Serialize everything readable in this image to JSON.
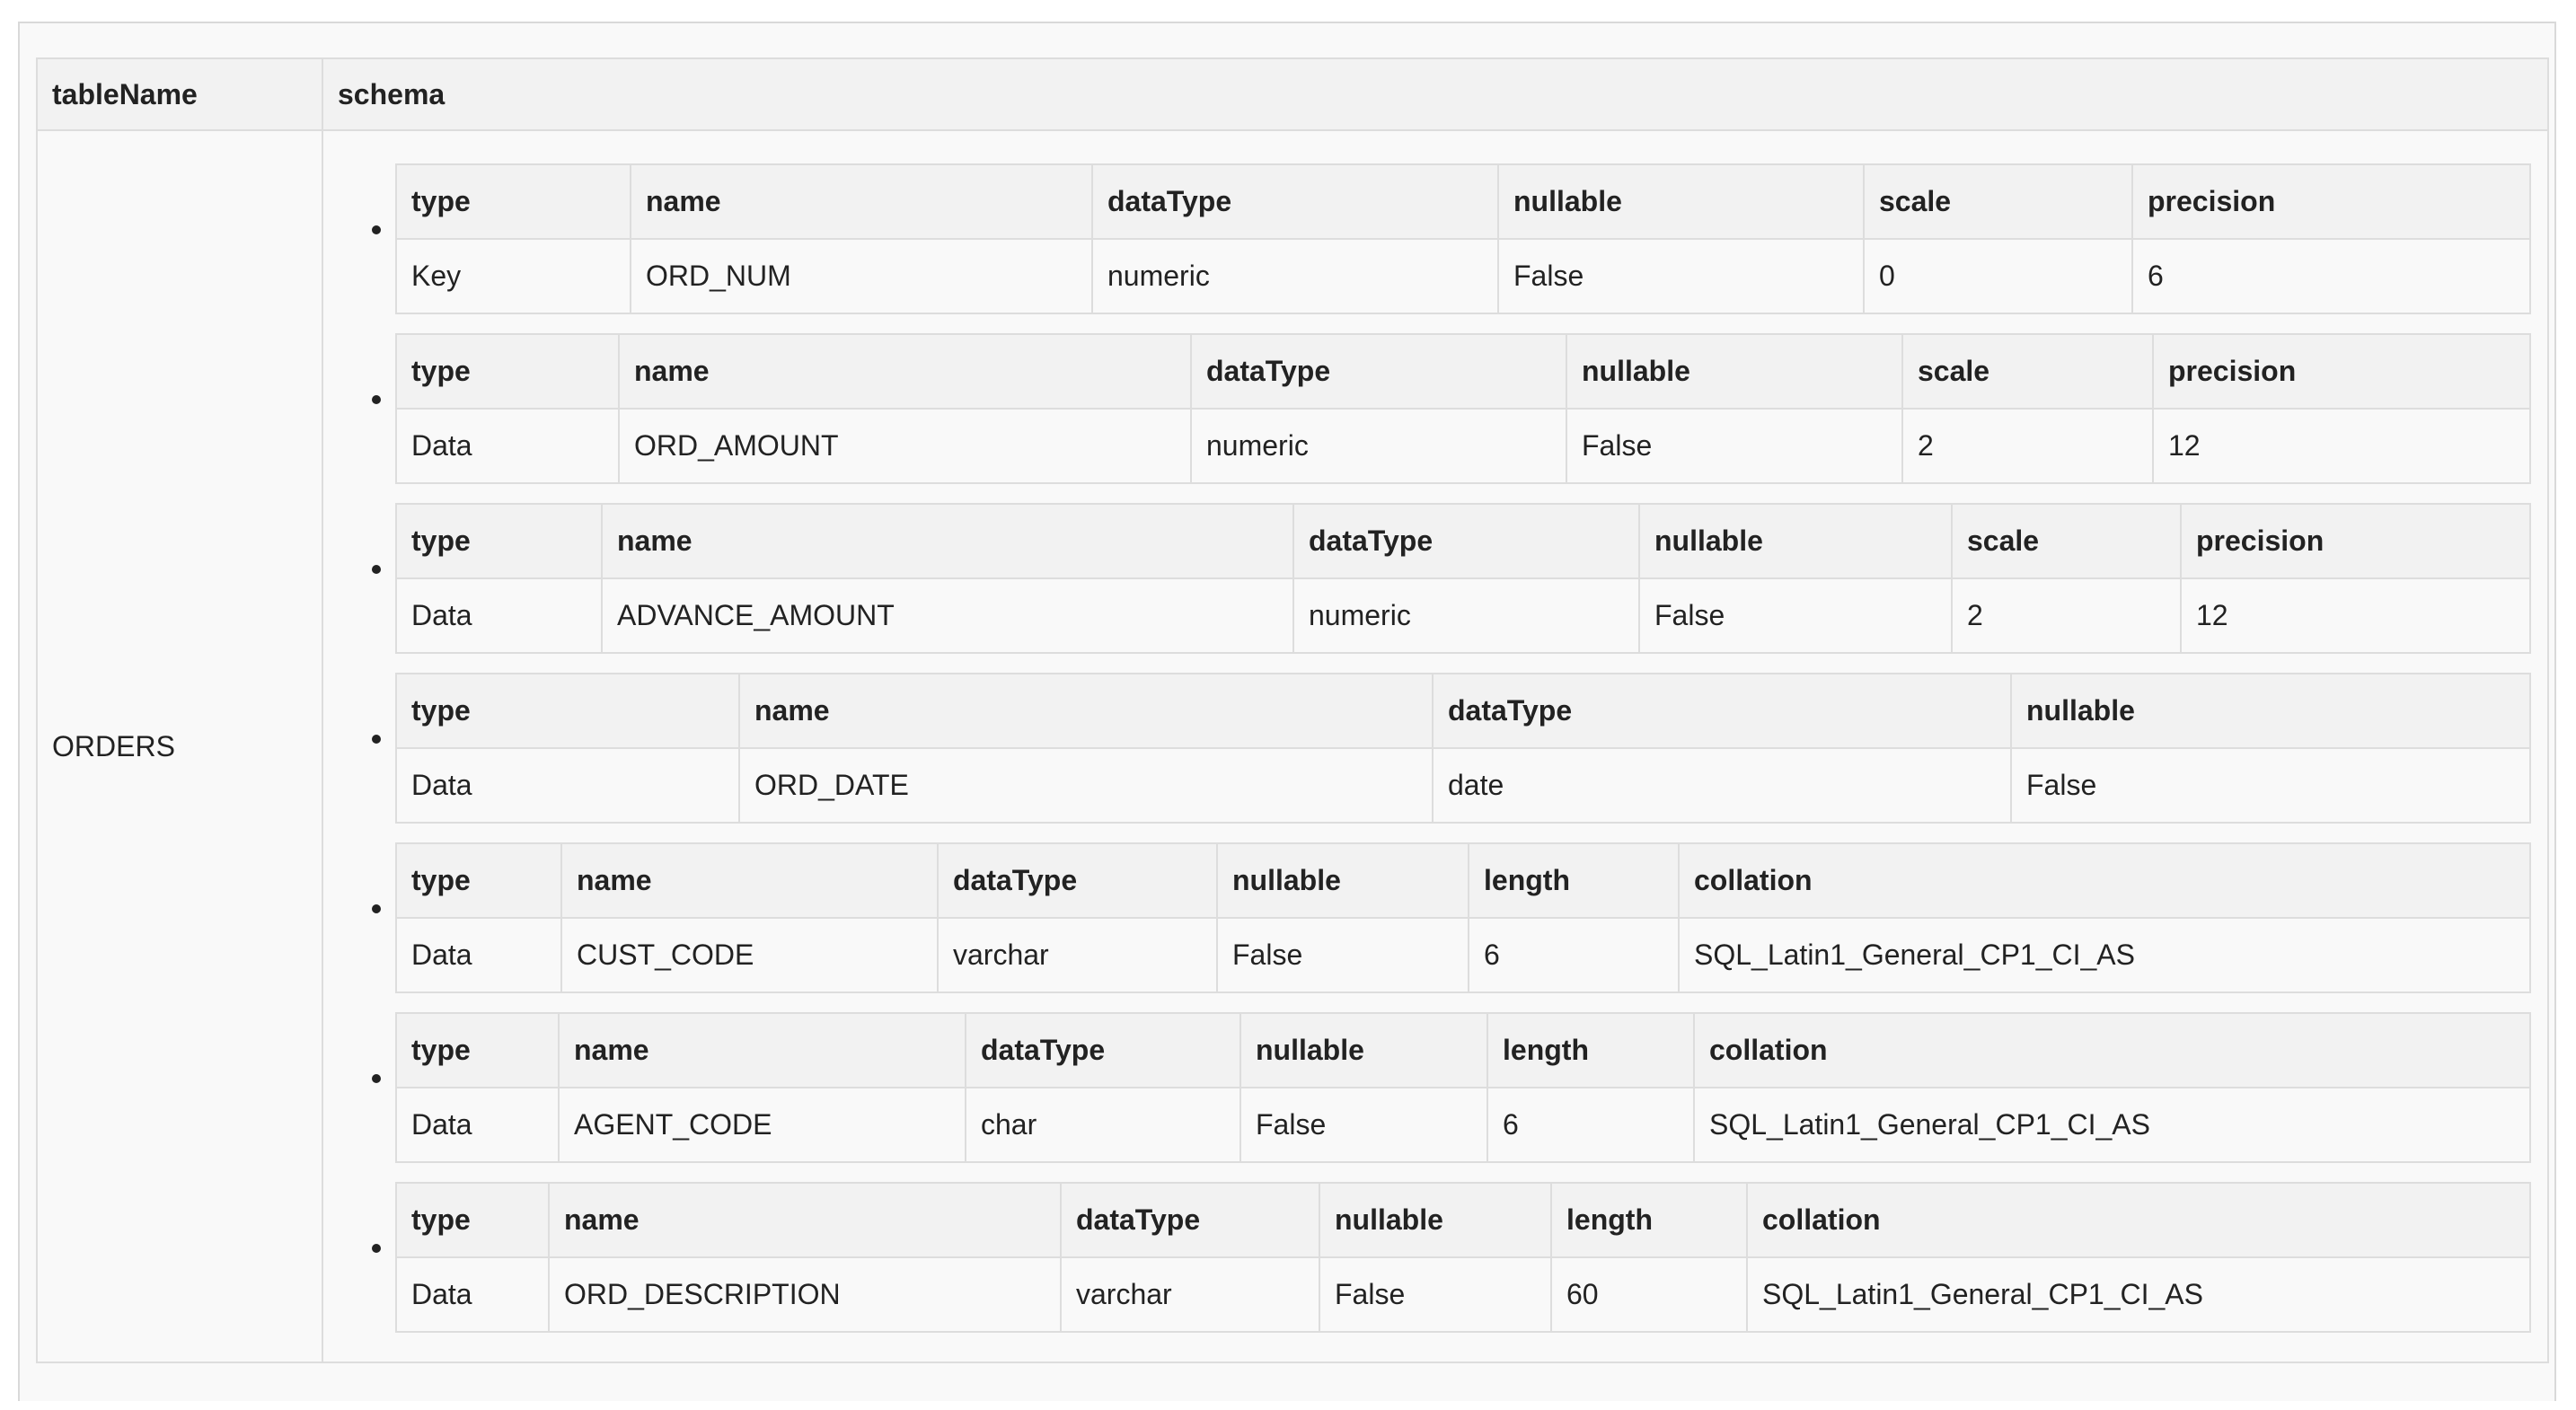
{
  "headers": {
    "table_name": "tableName",
    "schema": "schema"
  },
  "rows": [
    {
      "table_name": "ORDERS",
      "schema": [
        {
          "columns": [
            "type",
            "name",
            "dataType",
            "nullable",
            "scale",
            "precision"
          ],
          "values": [
            "Key",
            "ORD_NUM",
            "numeric",
            "False",
            "0",
            "6"
          ]
        },
        {
          "columns": [
            "type",
            "name",
            "dataType",
            "nullable",
            "scale",
            "precision"
          ],
          "values": [
            "Data",
            "ORD_AMOUNT",
            "numeric",
            "False",
            "2",
            "12"
          ]
        },
        {
          "columns": [
            "type",
            "name",
            "dataType",
            "nullable",
            "scale",
            "precision"
          ],
          "values": [
            "Data",
            "ADVANCE_AMOUNT",
            "numeric",
            "False",
            "2",
            "12"
          ]
        },
        {
          "columns": [
            "type",
            "name",
            "dataType",
            "nullable"
          ],
          "values": [
            "Data",
            "ORD_DATE",
            "date",
            "False"
          ]
        },
        {
          "columns": [
            "type",
            "name",
            "dataType",
            "nullable",
            "length",
            "collation"
          ],
          "values": [
            "Data",
            "CUST_CODE",
            "varchar",
            "False",
            "6",
            "SQL_Latin1_General_CP1_CI_AS"
          ]
        },
        {
          "columns": [
            "type",
            "name",
            "dataType",
            "nullable",
            "length",
            "collation"
          ],
          "values": [
            "Data",
            "AGENT_CODE",
            "char",
            "False",
            "6",
            "SQL_Latin1_General_CP1_CI_AS"
          ]
        },
        {
          "columns": [
            "type",
            "name",
            "dataType",
            "nullable",
            "length",
            "collation"
          ],
          "values": [
            "Data",
            "ORD_DESCRIPTION",
            "varchar",
            "False",
            "60",
            "SQL_Latin1_General_CP1_CI_AS"
          ]
        }
      ]
    }
  ]
}
